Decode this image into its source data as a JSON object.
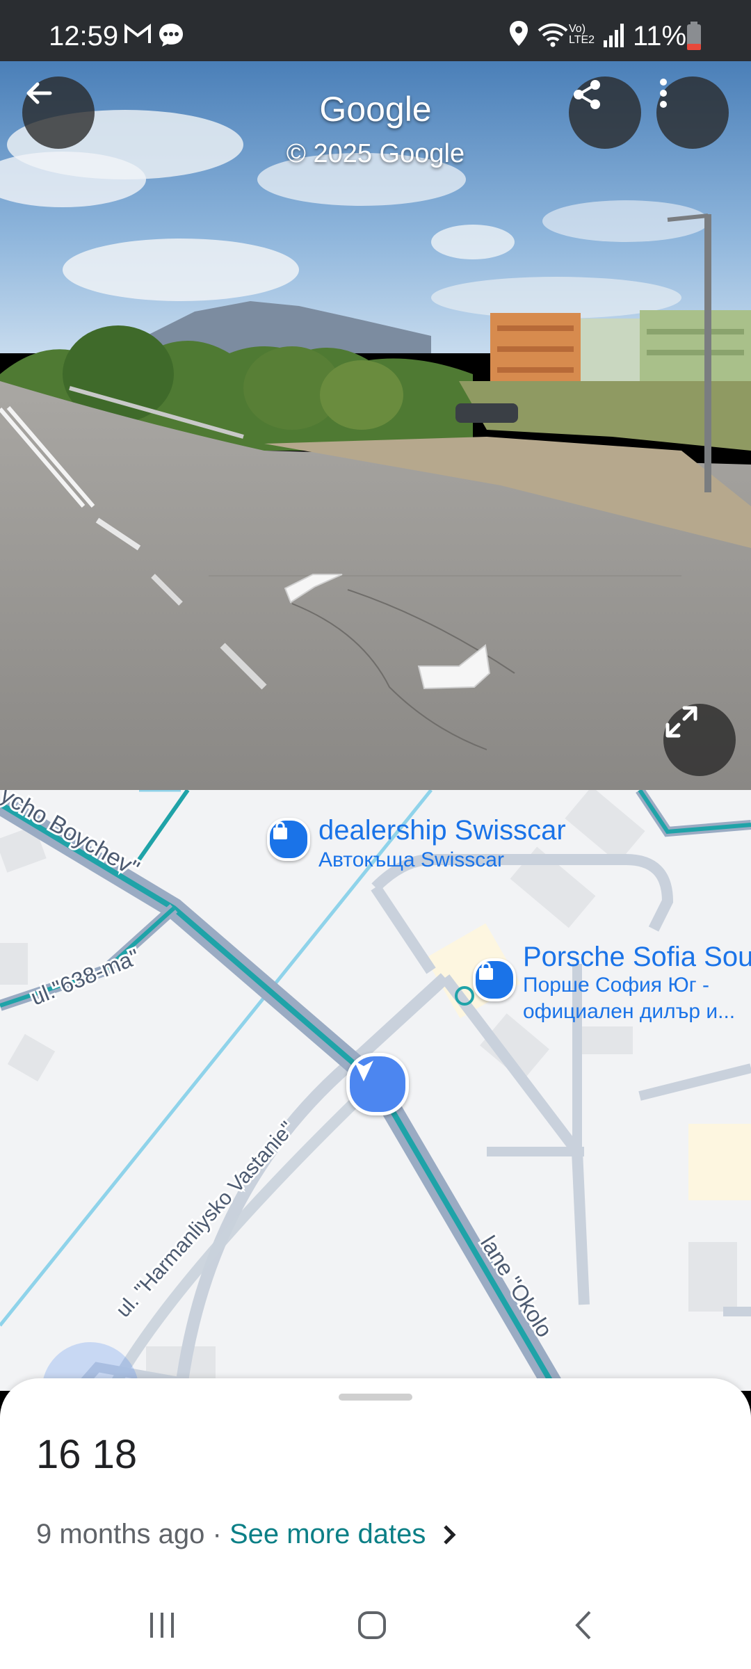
{
  "status_bar": {
    "time": "12:59",
    "battery": "11%",
    "icons": [
      "gmail-icon",
      "messages-icon",
      "location-icon",
      "wifi-icon",
      "volte-icon",
      "signal-icon",
      "battery-icon"
    ]
  },
  "street_view": {
    "title": "Google",
    "copyright": "© 2025 Google",
    "icons": [
      "back-arrow-icon",
      "share-icon",
      "more-vert-icon",
      "expand-icon",
      "nav-chevron-left-icon",
      "nav-chevron-right-icon"
    ]
  },
  "map": {
    "roads": {
      "boychev": "ycho Boychev\"",
      "ul638": "ul.\"638-ma\"",
      "harmanliysko": "ul. \"Harmanliysko Vastanie\"",
      "okolo": "lane \"Okolo"
    },
    "pois": {
      "swisscar": {
        "title": "dealership Swisscar",
        "subtitle": "Автокъща Swisscar"
      },
      "porsche": {
        "title": "Porsche Sofia Sou",
        "subtitle1": "Порше София Юг -",
        "subtitle2": "официален дилър и..."
      }
    },
    "colors": {
      "teal_route": "#1fa3a8",
      "road": "#c9d1dc",
      "water_line": "#8fd3ea",
      "poi": "#1a73e8"
    }
  },
  "sheet": {
    "title": "16 18",
    "date": "9 months ago",
    "separator": " · ",
    "see_more": "See more dates"
  },
  "nav_bar": {
    "icons": [
      "recents-icon",
      "home-icon",
      "back-icon"
    ]
  }
}
